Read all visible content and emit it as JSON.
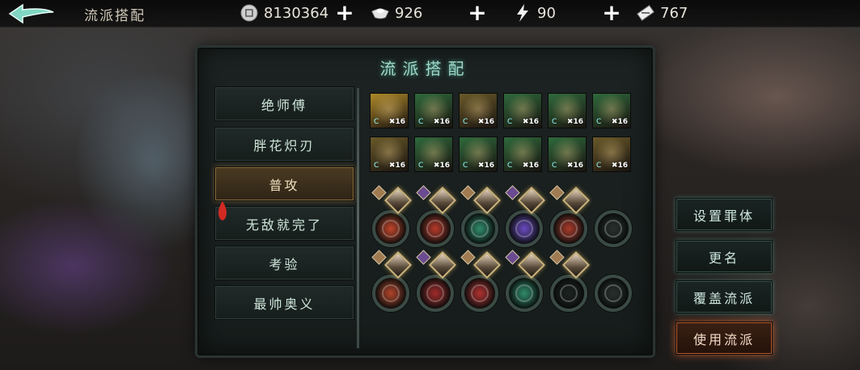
{
  "header": {
    "title": "流派搭配",
    "resources": [
      {
        "name": "coins",
        "icon": "coin-icon",
        "value": "8130364"
      },
      {
        "name": "silver",
        "icon": "ingot-icon",
        "value": "926"
      },
      {
        "name": "energy",
        "icon": "lightning-icon",
        "value": "90"
      },
      {
        "name": "tickets",
        "icon": "ticket-icon",
        "value": "767"
      }
    ]
  },
  "panel": {
    "title": "流派搭配",
    "tabs": [
      {
        "label": "绝师傅"
      },
      {
        "label": "胖花炽刃"
      },
      {
        "label": "普攻"
      },
      {
        "label": "无敌就完了"
      },
      {
        "label": "考验"
      },
      {
        "label": "最帅奥义"
      }
    ],
    "active_tab": "普攻",
    "equipment": [
      {
        "level": "16",
        "color": "#b08a2a",
        "icon": "sword-icon"
      },
      {
        "level": "16",
        "color": "#2f6a3c",
        "icon": "gauntlet-icon"
      },
      {
        "level": "16",
        "color": "#6a5a2a",
        "icon": "armor-icon"
      },
      {
        "level": "16",
        "color": "#2f6a3c",
        "icon": "cloak-icon"
      },
      {
        "level": "16",
        "color": "#2f6a3c",
        "icon": "boots-icon"
      },
      {
        "level": "16",
        "color": "#2f6a3c",
        "icon": "chain-icon"
      },
      {
        "level": "16",
        "color": "#6a5a2a",
        "icon": "bracer-icon"
      },
      {
        "level": "16",
        "color": "#2f6a3c",
        "icon": "robe-icon"
      },
      {
        "level": "16",
        "color": "#2f6a3c",
        "icon": "vest-icon"
      },
      {
        "level": "16",
        "color": "#2f6a3c",
        "icon": "belt-icon"
      },
      {
        "level": "16",
        "color": "#2f6a3c",
        "icon": "shoes-icon"
      },
      {
        "level": "16",
        "color": "#6a5a2a",
        "icon": "blade-icon"
      }
    ],
    "skill_row_1": [
      {
        "color": "#c0442a",
        "icon": "fire-skill-icon"
      },
      {
        "color": "#b63a2a",
        "icon": "flame-skill-icon"
      },
      {
        "color": "#2f8a6a",
        "icon": "cross-skill-icon"
      },
      {
        "color": "#6a4ac0",
        "icon": "void-skill-icon"
      },
      {
        "color": "#a83a2a",
        "icon": "burst-skill-icon"
      },
      {
        "color": "#28302e",
        "icon": "empty-skill-icon"
      }
    ],
    "skill_row_2": [
      {
        "color": "#b0442a",
        "icon": "wave-skill-icon"
      },
      {
        "color": "#a02a2a",
        "icon": "spiral-skill-icon"
      },
      {
        "color": "#b03030",
        "icon": "wheel-skill-icon"
      },
      {
        "color": "#2f8a6a",
        "icon": "hook-skill-icon"
      },
      {
        "color": "#1c2220",
        "icon": "empty-skill-icon"
      },
      {
        "color": "#28302e",
        "icon": "empty-skill-icon"
      }
    ]
  },
  "actions": {
    "set_body": "设置罪体",
    "rename": "更名",
    "overwrite": "覆盖流派",
    "use": "使用流派"
  }
}
